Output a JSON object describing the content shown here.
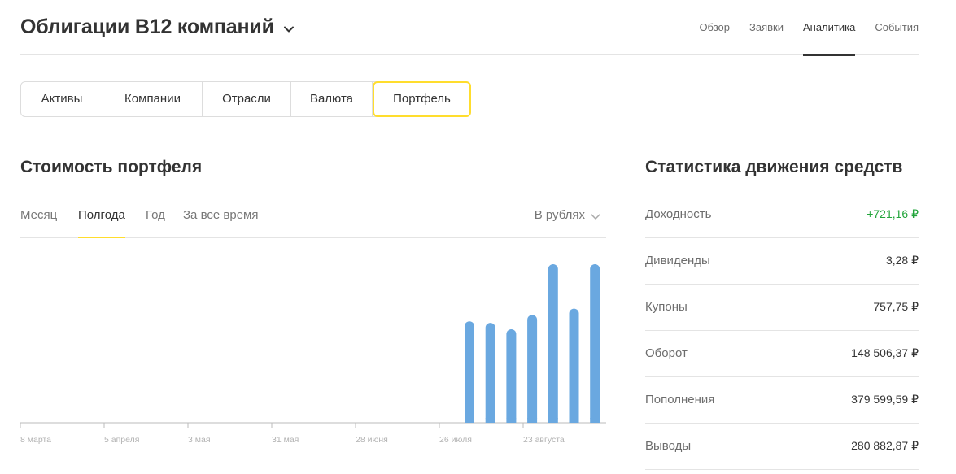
{
  "header": {
    "title": "Облигации В12 компаний",
    "nav": [
      "Обзор",
      "Заявки",
      "Аналитика",
      "События"
    ],
    "active_nav": "Аналитика"
  },
  "segments": {
    "items": [
      "Активы",
      "Компании",
      "Отрасли",
      "Валюта",
      "Портфель"
    ],
    "active": "Портфель"
  },
  "portfolio": {
    "title": "Стоимость портфеля",
    "periods": [
      "Месяц",
      "Полгода",
      "Год",
      "За все время"
    ],
    "active_period": "Полгода",
    "currency_label": "В рублях"
  },
  "chart_data": {
    "type": "bar",
    "x_tick_labels": [
      "8 марта",
      "5 апреля",
      "3 мая",
      "31 мая",
      "28 июня",
      "26 июля",
      "23 августа"
    ],
    "bars": [
      {
        "after_tick": "26 июля",
        "value": 0.64
      },
      {
        "after_tick": "26 июля",
        "value": 0.63
      },
      {
        "after_tick": "26 июля",
        "value": 0.59
      },
      {
        "after_tick": "23 августа",
        "value": 0.68
      },
      {
        "after_tick": "23 августа",
        "value": 1.0
      },
      {
        "after_tick": "23 августа",
        "value": 0.72
      },
      {
        "after_tick": "23 августа",
        "value": 1.0
      }
    ],
    "value_scale": "relative (no y axis shown)",
    "color": "#6aa8e0",
    "grid": false,
    "legend": "none"
  },
  "stats": {
    "title": "Статистика движения средств",
    "rows": [
      {
        "label": "Доходность",
        "value": "+721,16 ₽",
        "positive": true
      },
      {
        "label": "Дивиденды",
        "value": "3,28 ₽",
        "positive": false
      },
      {
        "label": "Купоны",
        "value": "757,75 ₽",
        "positive": false
      },
      {
        "label": "Оборот",
        "value": "148 506,37 ₽",
        "positive": false
      },
      {
        "label": "Пополнения",
        "value": "379 599,59 ₽",
        "positive": false
      },
      {
        "label": "Выводы",
        "value": "280 882,87 ₽",
        "positive": false
      }
    ]
  },
  "colors": {
    "accent": "#ffdd2d",
    "bar": "#6aa8e0",
    "positive": "#22a53b",
    "text": "#333333",
    "muted": "#6d6d6d"
  }
}
